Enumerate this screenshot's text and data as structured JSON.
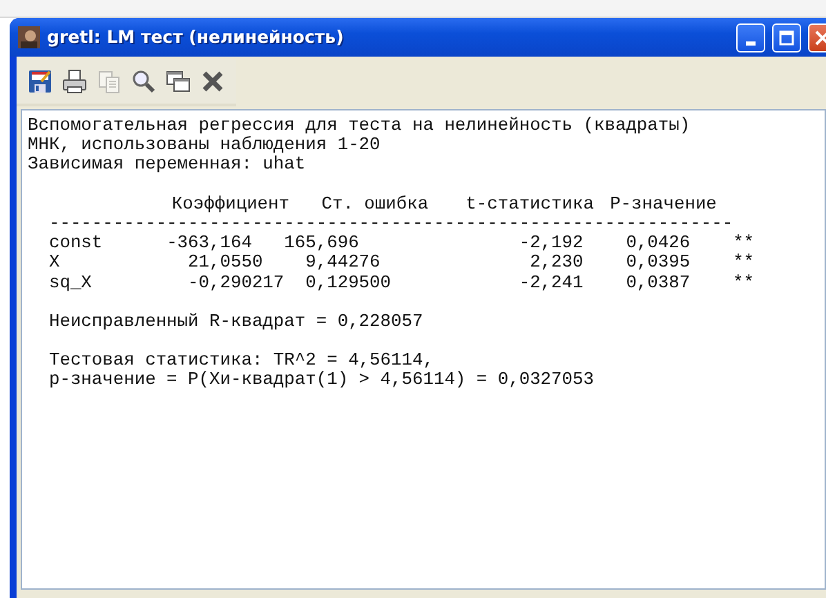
{
  "window": {
    "title": "gretl: LM тест (нелинейность)"
  },
  "toolbar": [
    {
      "kind": "save",
      "disabled": false
    },
    {
      "kind": "print",
      "disabled": false
    },
    {
      "kind": "copy",
      "disabled": true
    },
    {
      "kind": "zoom",
      "disabled": false
    },
    {
      "kind": "windows",
      "disabled": false
    },
    {
      "kind": "close",
      "disabled": false
    }
  ],
  "output": {
    "header_lines": [
      "Вспомогательная регрессия для теста на нелинейность (квадраты)",
      "МНК, использованы наблюдения 1-20",
      "Зависимая переменная: uhat"
    ],
    "columns": [
      "Коэффициент",
      "Ст. ошибка",
      "t-статистика",
      "P-значение"
    ],
    "rule": "----------------------------------------------------------------",
    "rows": [
      {
        "name": "const",
        "coefficient": "-363,164",
        "std_error": "165,696",
        "t_stat": "-2,192",
        "p_value": "0,0426",
        "stars": "**"
      },
      {
        "name": "X",
        "coefficient": "21,0550",
        "std_error": "9,44276",
        "t_stat": "2,230",
        "p_value": "0,0395",
        "stars": "**"
      },
      {
        "name": "sq_X",
        "coefficient": "-0,290217",
        "std_error": "0,129500",
        "t_stat": "-2,241",
        "p_value": "0,0387",
        "stars": "**"
      }
    ],
    "r_squared_line": "Неисправленный R-квадрат = 0,228057",
    "test_lines": [
      "Тестовая статистика: TR^2 = 4,56114,",
      "p-значение = P(Хи-квадрат(1) > 4,56114) = 0,0327053"
    ]
  }
}
